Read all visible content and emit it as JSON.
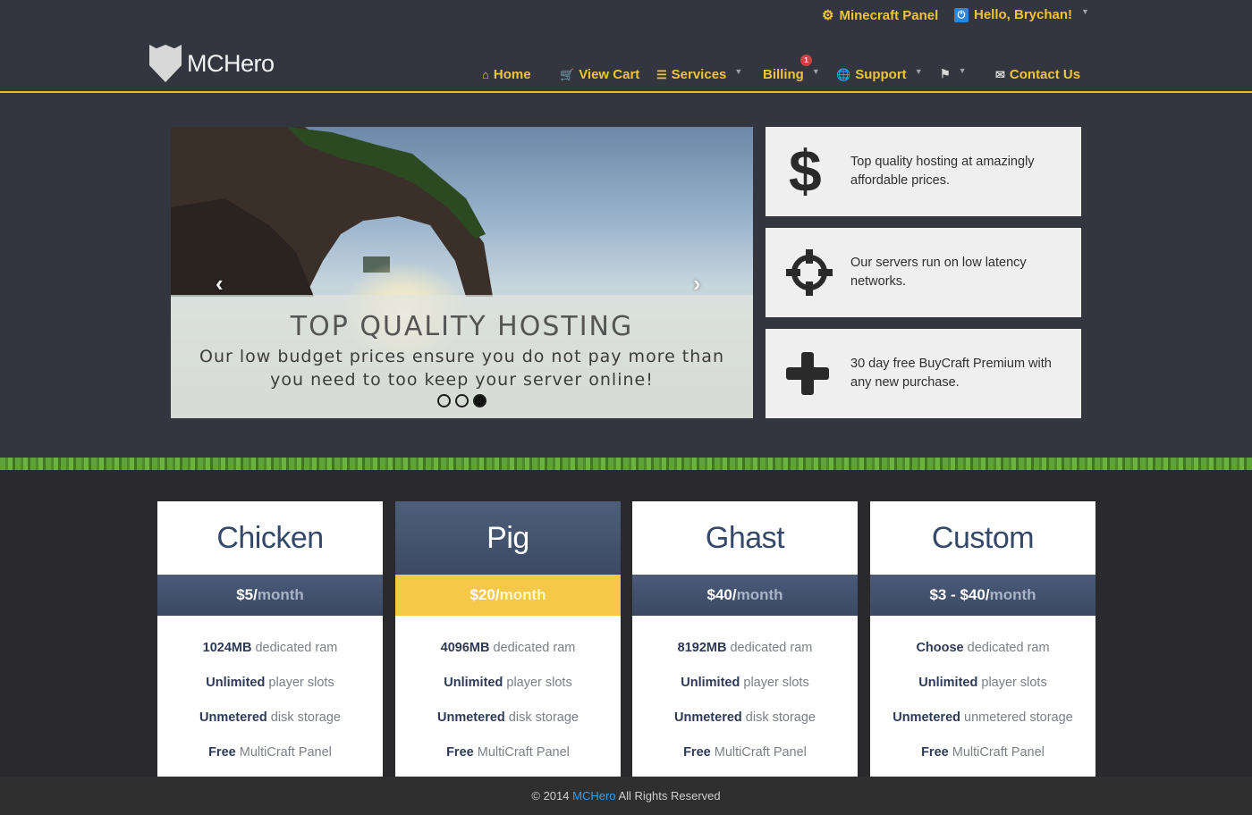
{
  "header": {
    "panel_link": "Minecraft Panel",
    "user_greeting": "Hello, Brychan!",
    "logo_text": "MCHero",
    "accent_color": "#f0c23a"
  },
  "nav": {
    "items": [
      {
        "label": "Home",
        "icon": "home-icon"
      },
      {
        "label": "View Cart",
        "icon": "cart-icon"
      },
      {
        "label": "Services",
        "icon": "list-icon"
      },
      {
        "label": "Billing",
        "badge": "1"
      },
      {
        "label": "Support",
        "icon": "globe-icon"
      },
      {
        "label": "",
        "icon": "flag-icon"
      },
      {
        "label": "Contact Us",
        "icon": "envelope-icon"
      }
    ]
  },
  "carousel": {
    "title": "TOP QUALITY HOSTING",
    "text": "Our low budget prices ensure you do not pay more than you need to too keep your server online!",
    "slide_count": 3,
    "active_slide": 3
  },
  "features": [
    {
      "icon": "dollar-icon",
      "text": "Top quality hosting at amazingly affordable prices."
    },
    {
      "icon": "crosshair-icon",
      "text": "Our servers run on low latency networks."
    },
    {
      "icon": "plus-icon",
      "text": "30 day free BuyCraft Premium with any new purchase."
    }
  ],
  "plans": [
    {
      "name": "Chicken",
      "price": "$5/",
      "per": "month",
      "features": [
        {
          "strong": "1024MB",
          "rest": "dedicated ram"
        },
        {
          "strong": "Unlimited",
          "rest": "player slots"
        },
        {
          "strong": "Unmetered",
          "rest": "disk storage"
        },
        {
          "strong": "Free",
          "rest": "MultiCraft Panel"
        }
      ]
    },
    {
      "name": "Pig",
      "price": "$20/",
      "per": "month",
      "features": [
        {
          "strong": "4096MB",
          "rest": "dedicated ram"
        },
        {
          "strong": "Unlimited",
          "rest": "player slots"
        },
        {
          "strong": "Unmetered",
          "rest": "disk storage"
        },
        {
          "strong": "Free",
          "rest": "MultiCraft Panel"
        }
      ]
    },
    {
      "name": "Ghast",
      "price": "$40/",
      "per": "month",
      "features": [
        {
          "strong": "8192MB",
          "rest": "dedicated ram"
        },
        {
          "strong": "Unlimited",
          "rest": "player slots"
        },
        {
          "strong": "Unmetered",
          "rest": "disk storage"
        },
        {
          "strong": "Free",
          "rest": "MultiCraft Panel"
        }
      ]
    },
    {
      "name": "Custom",
      "price": "$3 - $40/",
      "per": "month",
      "features": [
        {
          "strong": "Choose",
          "rest": "dedicated ram"
        },
        {
          "strong": "Unlimited",
          "rest": "player slots"
        },
        {
          "strong": "Unmetered",
          "rest": "unmetered storage"
        },
        {
          "strong": "Free",
          "rest": "MultiCraft Panel"
        }
      ]
    }
  ],
  "footer": {
    "prefix": "© 2014",
    "brand": "MCHero",
    "suffix": "All Rights Reserved"
  }
}
